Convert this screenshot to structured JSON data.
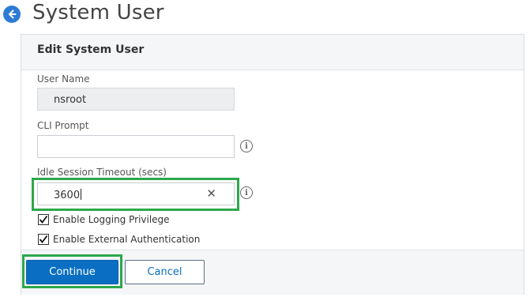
{
  "header": {
    "title": "System User"
  },
  "panel": {
    "title": "Edit System User"
  },
  "fields": {
    "username": {
      "label": "User Name",
      "value": "nsroot"
    },
    "cli_prompt": {
      "label": "CLI Prompt",
      "value": ""
    },
    "idle_timeout": {
      "label": "Idle Session Timeout (secs)",
      "value": "3600"
    }
  },
  "checkboxes": [
    {
      "label": "Enable Logging Privilege",
      "checked": true
    },
    {
      "label": "Enable External Authentication",
      "checked": true
    }
  ],
  "buttons": {
    "continue": "Continue",
    "cancel": "Cancel"
  },
  "icons": {
    "info": "i",
    "clear": "✕"
  },
  "colors": {
    "primary": "#0a6fc2",
    "highlight": "#2ca84a",
    "back": "#2e7bd6"
  }
}
